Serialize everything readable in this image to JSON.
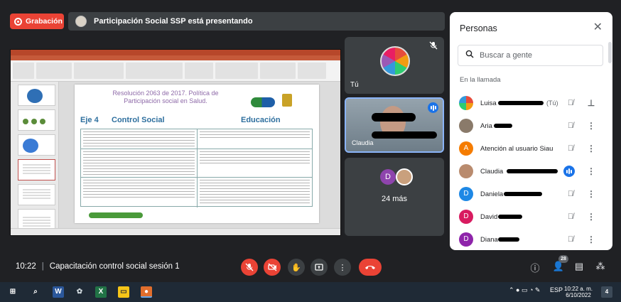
{
  "recording": {
    "label": "Grabación",
    "color": "#ea4335"
  },
  "presenting": {
    "text": "Participación Social SSP está presentando"
  },
  "slide": {
    "title_line1": "Resolución 2063 de 2017. Política de",
    "title_line2": "Participación social en Salud.",
    "eje": "Eje 4",
    "control_social": "Control Social",
    "educacion": "Educación"
  },
  "tiles": {
    "self_label": "Tú",
    "more_initial": "D",
    "more_label": "24 más"
  },
  "people_panel": {
    "title": "Personas",
    "search_placeholder": "Buscar a gente",
    "section": "En la llamada",
    "you_suffix": "(Tú)",
    "participants": [
      {
        "name": "Luisa",
        "initial": "",
        "color": "#e8a33d",
        "mic_icon": "mic-off-icon",
        "action_icon": "pin-icon"
      },
      {
        "name": "Aria",
        "initial": "",
        "color": "#8a7a6a",
        "mic_icon": "mic-off-icon",
        "action_icon": "more-vert-icon"
      },
      {
        "name": "Atención al usuario Siau",
        "initial": "A",
        "color": "#f57c00",
        "mic_icon": "mic-off-icon",
        "action_icon": "more-vert-icon"
      },
      {
        "name": "Claudia",
        "initial": "",
        "color": "#b98b6e",
        "mic_icon": "speaking-icon",
        "action_icon": "more-vert-icon"
      },
      {
        "name": "Daniela",
        "initial": "D",
        "color": "#1e88e5",
        "mic_icon": "mic-off-icon",
        "action_icon": "more-vert-icon"
      },
      {
        "name": "David",
        "initial": "D",
        "color": "#d81b60",
        "mic_icon": "mic-off-icon",
        "action_icon": "more-vert-icon"
      },
      {
        "name": "Diana",
        "initial": "D",
        "color": "#8e24aa",
        "mic_icon": "mic-off-icon",
        "action_icon": "more-vert-icon"
      }
    ]
  },
  "bottom": {
    "time": "10:22",
    "meeting_name": "Capacitación control social sesión 1",
    "participants_count": "28"
  },
  "taskbar": {
    "time": "10:22 a. m.",
    "date": "6/10/2022",
    "lang": "ESP",
    "notifications": "4"
  }
}
